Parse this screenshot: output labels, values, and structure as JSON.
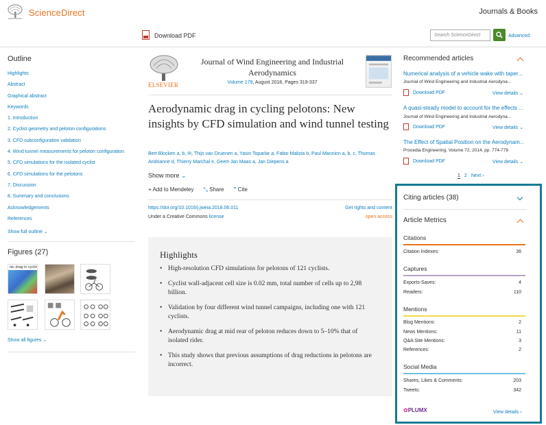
{
  "header": {
    "brand": "ScienceDirect",
    "journals_books": "Journals & Books",
    "download_pdf": "Download PDF",
    "search_placeholder": "Search ScienceDirect",
    "advanced": "Advanced"
  },
  "outline": {
    "title": "Outline",
    "items": [
      "Highlights",
      "Abstract",
      "Graphical abstract",
      "Keywords",
      "1. Introduction",
      "2. Cyclist geometry and peloton configurations",
      "3. CFD subconfiguration validation",
      "4. Wind tunnel measurements for peloton configuration",
      "5. CFD simulations for the isolated cyclist",
      "6. CFD simulations for the pelotons",
      "7. Discussion",
      "8. Summary and conclusions",
      "Acknowledgements",
      "References"
    ],
    "show_full": "Show full outline",
    "figures_title": "Figures (27)",
    "figure_caption": "nic drag in cycling",
    "show_all_figures": "Show all figures"
  },
  "article": {
    "publisher": "ELSEVIER",
    "journal": "Journal of Wind Engineering and Industrial Aerodynamics",
    "volume_link": "Volume 179",
    "volume_rest": ", August 2018, Pages 319-337",
    "title": "Aerodynamic drag in cycling pelotons: New insights by CFD simulation and wind tunnel testing",
    "authors": "Bert Blocken a, b, ✉, Thijs van Druenen a, Yasin Toparlar a, Fabio Malizia b, Paul Mannion a, b, c, Thomas Andrianne d, Thierry Marchal e, Geert-Jan Maas a, Jan Diepens a",
    "show_more": "Show more",
    "add_mendeley": "Add to Mendeley",
    "share": "Share",
    "cite": "Cite",
    "doi": "https://doi.org/10.1016/j.jweia.2018.06.011",
    "rights": "Get rights and content",
    "license_prefix": "Under a Creative Commons ",
    "license_link": "license",
    "open_access": "open access"
  },
  "highlights": {
    "title": "Highlights",
    "items": [
      "High-resolution CFD simulations for pelotons of 121 cyclists.",
      "Cyclist wall-adjacent cell size is 0.02 mm, total number of cells up to 2,98 billion.",
      "Validation by four different wind tunnel campaigns, including one with 121 cyclists.",
      "Aerodynamic drag at mid rear of peloton reduces down to 5–10% that of isolated rider.",
      "This study shows that previous assumptions of drag reductions in pelotons are incorrect."
    ]
  },
  "recommended": {
    "title": "Recommended articles",
    "items": [
      {
        "title": "Numerical analysis of a vehicle wake with taper...",
        "source": "Journal of Wind Engineering and Industrial Aerodyna...",
        "download": "Download PDF",
        "view": "View details"
      },
      {
        "title": "A quasi-steady model to account for the effects ...",
        "source": "Journal of Wind Engineering and Industrial Aerodyna...",
        "download": "Download PDF",
        "view": "View details"
      },
      {
        "title": "The Effect of Spatial Position on the Aerodynam...",
        "source": "Procedia Engineering, Volume 72, 2014, pp. 774-779",
        "download": "Download PDF",
        "view": "View details"
      }
    ],
    "pages": [
      "1",
      "2"
    ],
    "next": "Next"
  },
  "metrics": {
    "citing": "Citing articles (38)",
    "article_metrics": "Article Metrics",
    "sections": [
      {
        "title": "Citations",
        "color": "#e9711c",
        "rows": [
          {
            "label": "Citation Indexes:",
            "value": "36"
          }
        ]
      },
      {
        "title": "Captures",
        "color": "#b9a0c8",
        "rows": [
          {
            "label": "Exports-Saves:",
            "value": "4"
          },
          {
            "label": "Readers:",
            "value": "110"
          }
        ]
      },
      {
        "title": "Mentions",
        "color": "#f0d94a",
        "rows": [
          {
            "label": "Blog Mentions:",
            "value": "2"
          },
          {
            "label": "News Mentions:",
            "value": "11"
          },
          {
            "label": "Q&A Site Mentions:",
            "value": "3"
          },
          {
            "label": "References:",
            "value": "2"
          }
        ]
      },
      {
        "title": "Social Media",
        "color": "#6fbfe0",
        "rows": [
          {
            "label": "Shares, Likes & Comments:",
            "value": "203"
          },
          {
            "label": "Tweets:",
            "value": "342"
          }
        ]
      }
    ],
    "plumx": "PLUMX",
    "view_details": "View details"
  }
}
